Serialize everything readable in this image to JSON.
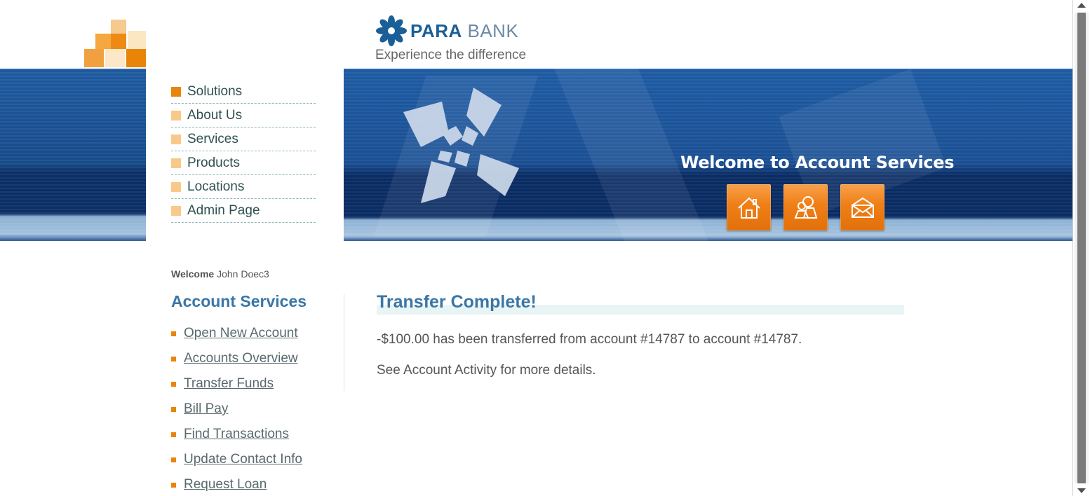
{
  "header": {
    "brand_para": "PARA",
    "brand_bank": "BANK",
    "caption": "Experience the difference",
    "banner_title": "Welcome to Account Services",
    "icons": [
      "home-icon",
      "contact-icon",
      "email-icon"
    ]
  },
  "left_menu": {
    "items": [
      {
        "label": "Solutions"
      },
      {
        "label": "About Us"
      },
      {
        "label": "Services"
      },
      {
        "label": "Products"
      },
      {
        "label": "Locations"
      },
      {
        "label": "Admin Page"
      }
    ]
  },
  "account_panel": {
    "welcome_label": "Welcome",
    "user_name": "John Doec3",
    "title": "Account Services",
    "links": [
      {
        "label": "Open New Account"
      },
      {
        "label": "Accounts Overview"
      },
      {
        "label": "Transfer Funds"
      },
      {
        "label": "Bill Pay"
      },
      {
        "label": "Find Transactions"
      },
      {
        "label": "Update Contact Info"
      },
      {
        "label": "Request Loan"
      }
    ]
  },
  "content": {
    "title": "Transfer Complete!",
    "message": "-$100.00 has been transferred from account #14787 to account #14787.",
    "details": "See Account Activity for more details."
  },
  "colors": {
    "accent_orange": "#e8850b",
    "heading_blue": "#3a76a6",
    "band_blue": "#1a4f93"
  }
}
